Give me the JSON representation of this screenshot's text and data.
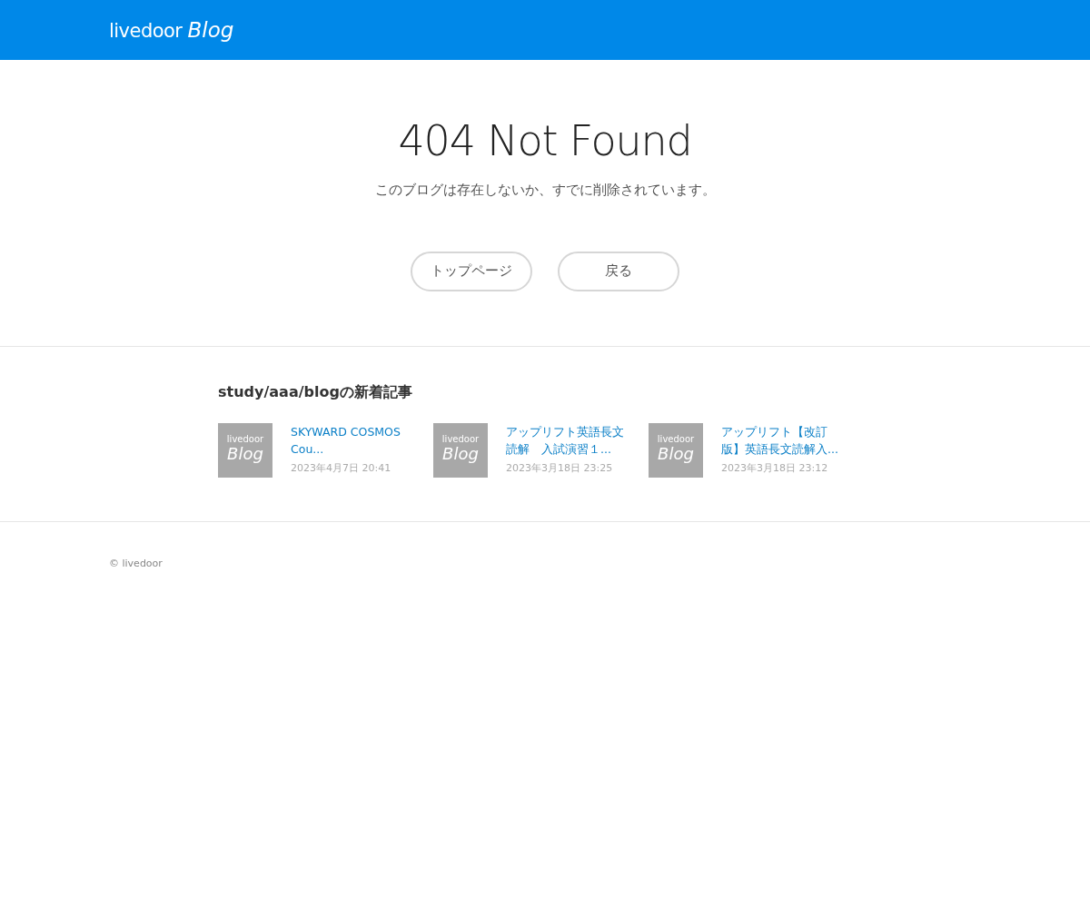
{
  "header": {
    "logo": {
      "brand": "livedoor",
      "product": "Blog"
    }
  },
  "error": {
    "title": "404 Not Found",
    "message": "このブログは存在しないか、すでに削除されています。"
  },
  "buttons": [
    "トップページ",
    "戻る"
  ],
  "recent": {
    "heading": "study/aaa/blogの新着記事",
    "articles": [
      {
        "thumb": {
          "brand": "livedoor",
          "product": "Blog"
        },
        "title": "SKYWARD COSMOS Cou...",
        "date": "2023年4月7日 20:41"
      },
      {
        "thumb": {
          "brand": "livedoor",
          "product": "Blog"
        },
        "title": "アップリフト英語長文読解　入試演習１...",
        "date": "2023年3月18日 23:25"
      },
      {
        "thumb": {
          "brand": "livedoor",
          "product": "Blog"
        },
        "title": "アップリフト【改訂版】英語長文読解入...",
        "date": "2023年3月18日 23:12"
      }
    ]
  },
  "footer": {
    "copyright": "© livedoor"
  }
}
